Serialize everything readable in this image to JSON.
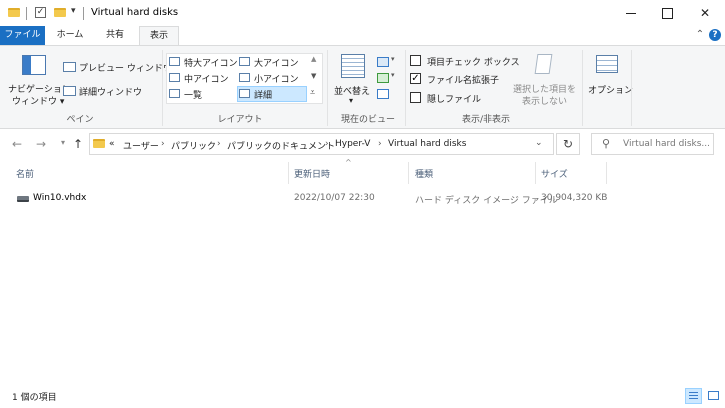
{
  "window": {
    "title": "Virtual hard disks",
    "controls": {
      "minimize": "",
      "maximize": "",
      "close": "✕",
      "help": "?"
    }
  },
  "ribbon_tabs": [
    "ファイル",
    "ホーム",
    "共有",
    "表示"
  ],
  "ribbon": {
    "pane_group": {
      "navigation_pane": [
        "ナビゲーション",
        "ウィンドウ ▾"
      ],
      "preview_pane": "プレビュー ウィンドウ",
      "details_pane": "詳細ウィンドウ",
      "label": "ペイン"
    },
    "layout_group": {
      "items": [
        "特大アイコン",
        "大アイコン",
        "中アイコン",
        "小アイコン",
        "一覧",
        "詳細"
      ],
      "selected": "詳細",
      "label": "レイアウト"
    },
    "current_view_group": {
      "sort": [
        "並べ替え",
        "▾"
      ],
      "label": "現在のビュー"
    },
    "show_hide_group": {
      "checkboxes": [
        {
          "label": "項目チェック ボックス",
          "checked": false
        },
        {
          "label": "ファイル名拡張子",
          "checked": true
        },
        {
          "label": "隠しファイル",
          "checked": false
        }
      ],
      "hide_selected": [
        "選択した項目を",
        "表示しない"
      ],
      "label": "表示/非表示"
    },
    "options": "オプション"
  },
  "address": {
    "prefix": "«",
    "path": [
      "ユーザー",
      "パブリック",
      "パブリックのドキュメント",
      "Hyper-V",
      "Virtual hard disks"
    ],
    "search_placeholder": "Virtual hard disks..."
  },
  "columns": [
    "名前",
    "更新日時",
    "種類",
    "サイズ"
  ],
  "files": [
    {
      "name": "Win10.vhdx",
      "modified": "2022/10/07 22:30",
      "type": "ハード ディスク イメージ ファイル",
      "size": "30,904,320 KB"
    }
  ],
  "status": {
    "count": "1 個の項目"
  },
  "colors": {
    "file_tab": "#1a6fc3",
    "selected_layout": "#cce8ff",
    "header_text": "#4c607a"
  }
}
